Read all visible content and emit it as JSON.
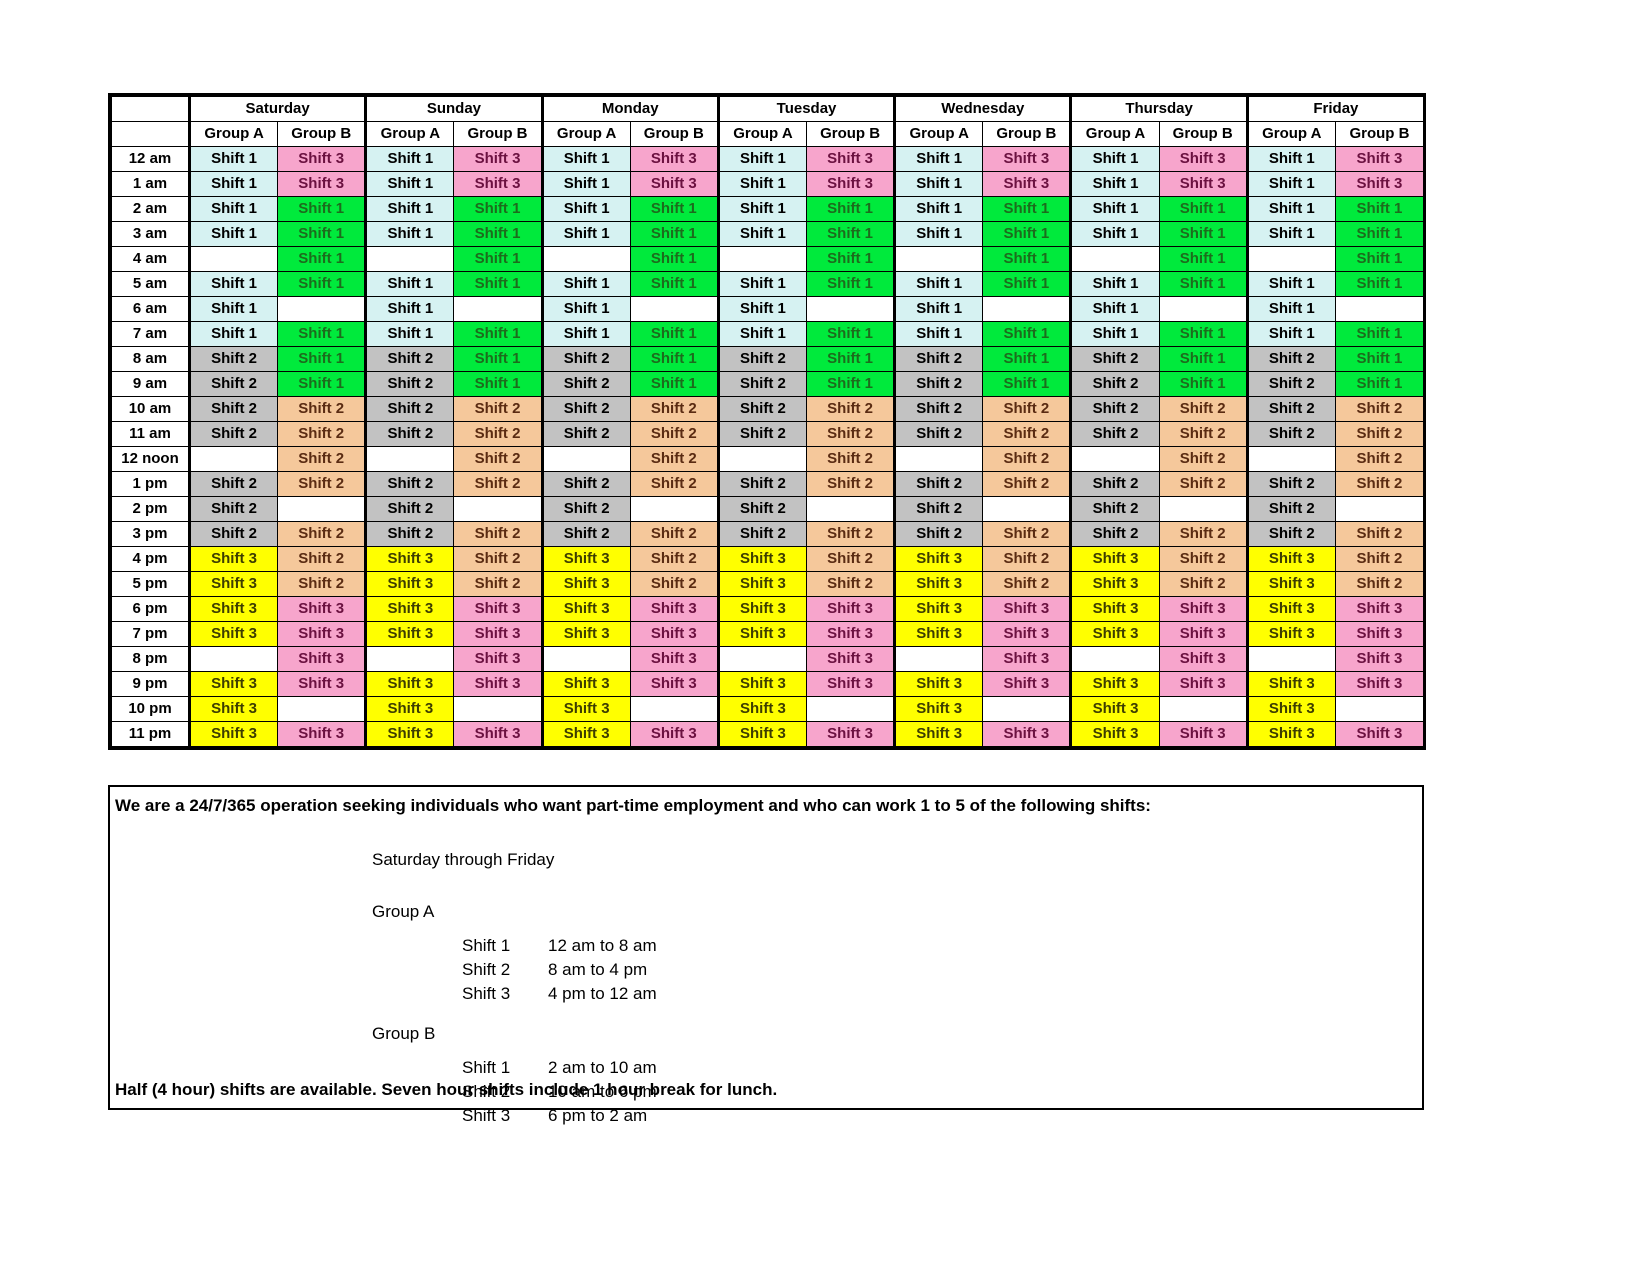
{
  "schedule": {
    "days": [
      "Saturday",
      "Sunday",
      "Monday",
      "Tuesday",
      "Wednesday",
      "Thursday",
      "Friday"
    ],
    "group_headers": [
      "Group A",
      "Group B"
    ],
    "times": [
      "12 am",
      "1 am",
      "2 am",
      "3 am",
      "4 am",
      "5 am",
      "6 am",
      "7 am",
      "8 am",
      "9 am",
      "10 am",
      "11 am",
      "12 noon",
      "1 pm",
      "2 pm",
      "3 pm",
      "4 pm",
      "5 pm",
      "6 pm",
      "7 pm",
      "8 pm",
      "9 pm",
      "10 pm",
      "11 pm"
    ],
    "labels": {
      "s1": "Shift 1",
      "s2": "Shift 2",
      "s3": "Shift 3",
      "empty": ""
    },
    "pattern": [
      {
        "time": "12 am",
        "a": "s1",
        "b": "s3"
      },
      {
        "time": "1 am",
        "a": "s1",
        "b": "s3"
      },
      {
        "time": "2 am",
        "a": "s1",
        "b": "s1"
      },
      {
        "time": "3 am",
        "a": "s1",
        "b": "s1"
      },
      {
        "time": "4 am",
        "a": "",
        "b": "s1"
      },
      {
        "time": "5 am",
        "a": "s1",
        "b": "s1"
      },
      {
        "time": "6 am",
        "a": "s1",
        "b": ""
      },
      {
        "time": "7 am",
        "a": "s1",
        "b": "s1"
      },
      {
        "time": "8 am",
        "a": "s2",
        "b": "s1"
      },
      {
        "time": "9 am",
        "a": "s2",
        "b": "s1"
      },
      {
        "time": "10 am",
        "a": "s2",
        "b": "s2"
      },
      {
        "time": "11 am",
        "a": "s2",
        "b": "s2"
      },
      {
        "time": "12 noon",
        "a": "",
        "b": "s2"
      },
      {
        "time": "1 pm",
        "a": "s2",
        "b": "s2"
      },
      {
        "time": "2 pm",
        "a": "s2",
        "b": ""
      },
      {
        "time": "3 pm",
        "a": "s2",
        "b": "s2"
      },
      {
        "time": "4 pm",
        "a": "s3",
        "b": "s2"
      },
      {
        "time": "5 pm",
        "a": "s3",
        "b": "s2"
      },
      {
        "time": "6 pm",
        "a": "s3",
        "b": "s3"
      },
      {
        "time": "7 pm",
        "a": "s3",
        "b": "s3"
      },
      {
        "time": "8 pm",
        "a": "",
        "b": "s3"
      },
      {
        "time": "9 pm",
        "a": "s3",
        "b": "s3"
      },
      {
        "time": "10 pm",
        "a": "s3",
        "b": ""
      },
      {
        "time": "11 pm",
        "a": "s3",
        "b": "s3"
      }
    ],
    "colors": {
      "group_a_shift1_bg": "#d6f2f2",
      "group_a_shift2_bg": "#c2c2c2",
      "group_a_shift3_bg": "#ffff00",
      "group_b_shift1_bg": "#00ea3c",
      "group_b_shift2_bg": "#f5c89b",
      "group_b_shift3_bg": "#f7a5cc"
    }
  },
  "description": {
    "headline": "We are a 24/7/365 operation seeking individuals who want part-time employment and who can work 1 to 5 of the following shifts:",
    "date_range": "Saturday through Friday",
    "groups": [
      {
        "title": "Group A",
        "shifts": [
          {
            "name": "Shift 1",
            "hours": "12 am to 8 am"
          },
          {
            "name": "Shift 2",
            "hours": "8 am to 4 pm"
          },
          {
            "name": "Shift 3",
            "hours": "4 pm to 12 am"
          }
        ]
      },
      {
        "title": "Group B",
        "shifts": [
          {
            "name": "Shift 1",
            "hours": "2 am to 10 am"
          },
          {
            "name": "Shift 2",
            "hours": "10 am to 6 pm"
          },
          {
            "name": "Shift 3",
            "hours": "6 pm to 2 am"
          }
        ]
      }
    ],
    "footnote": "Half (4 hour) shifts are available.  Seven hour shifts include 1 hour break for lunch."
  }
}
